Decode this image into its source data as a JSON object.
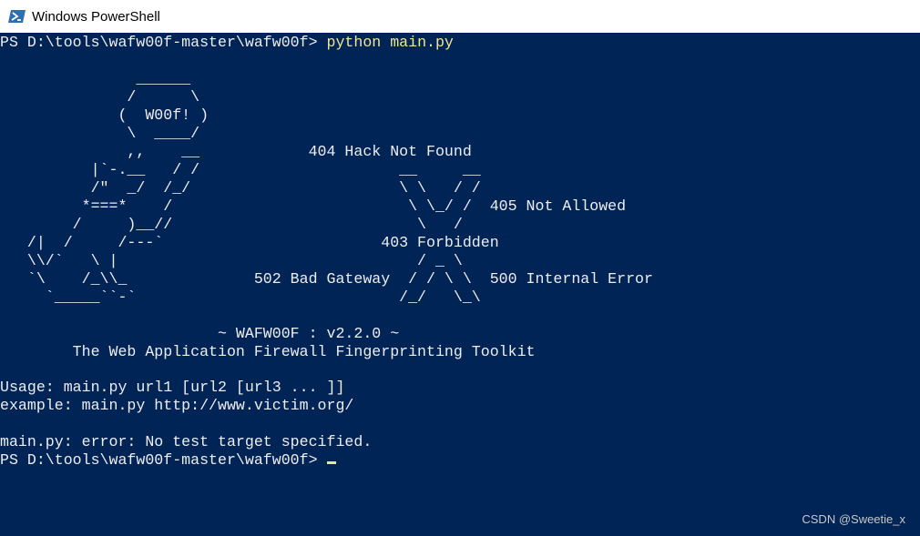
{
  "window": {
    "title": "Windows PowerShell",
    "icon": "powershell-icon"
  },
  "colors": {
    "console_bg": "#012456",
    "console_text": "#eeedf0",
    "command_text": "#f0e68c"
  },
  "console": {
    "prompt1": "PS D:\\tools\\wafw00f-master\\wafw00f> ",
    "command1": "python main.py",
    "ascii_art": [
      "               ______",
      "              /      \\",
      "             (  W00f! )",
      "              \\  ____/",
      "              ,,    __            404 Hack Not Found",
      "          |`-.__   / /                      __     __",
      "          /\"  _/  /_/                       \\ \\   / /",
      "         *===*    /                          \\ \\_/ /  405 Not Allowed",
      "        /     )__//                           \\   /",
      "   /|  /     /---`                        403 Forbidden",
      "   \\\\/`   \\ |                                 / _ \\",
      "   `\\    /_\\\\_              502 Bad Gateway  / / \\ \\  500 Internal Error",
      "     `_____``-`                             /_/   \\_\\",
      "",
      "                        ~ WAFW00F : v2.2.0 ~",
      "        The Web Application Firewall Fingerprinting Toolkit"
    ],
    "usage": "Usage: main.py url1 [url2 [url3 ... ]]",
    "example": "example: main.py http://www.victim.org/",
    "error": "main.py: error: No test target specified.",
    "prompt2": "PS D:\\tools\\wafw00f-master\\wafw00f> "
  },
  "watermark": "CSDN @Sweetie_x"
}
